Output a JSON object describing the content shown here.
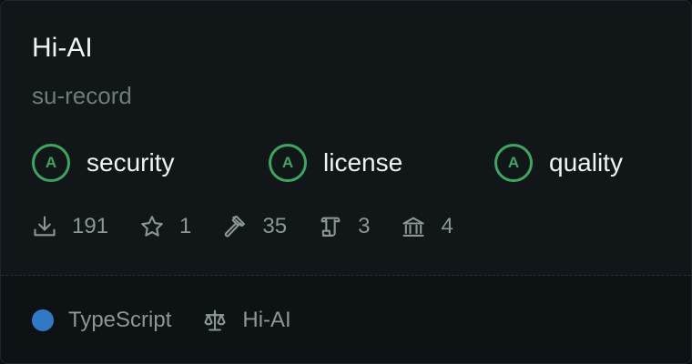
{
  "card": {
    "title": "Hi-AI",
    "subtitle": "su-record"
  },
  "badges": [
    {
      "grade": "A",
      "label": "security"
    },
    {
      "grade": "A",
      "label": "license"
    },
    {
      "grade": "A",
      "label": "quality"
    }
  ],
  "stats": [
    {
      "icon": "download-icon",
      "value": "191"
    },
    {
      "icon": "star-icon",
      "value": "1"
    },
    {
      "icon": "hammer-icon",
      "value": "35"
    },
    {
      "icon": "scroll-icon",
      "value": "3"
    },
    {
      "icon": "bank-icon",
      "value": "4"
    }
  ],
  "footer": {
    "language": "TypeScript",
    "language_color": "#3178c6",
    "license_icon": "scale-icon",
    "license": "Hi-AI"
  },
  "colors": {
    "grade_green": "#3fa462",
    "title": "#f0f3f6",
    "muted": "#8c9692",
    "subtitle": "#6b7d78"
  }
}
